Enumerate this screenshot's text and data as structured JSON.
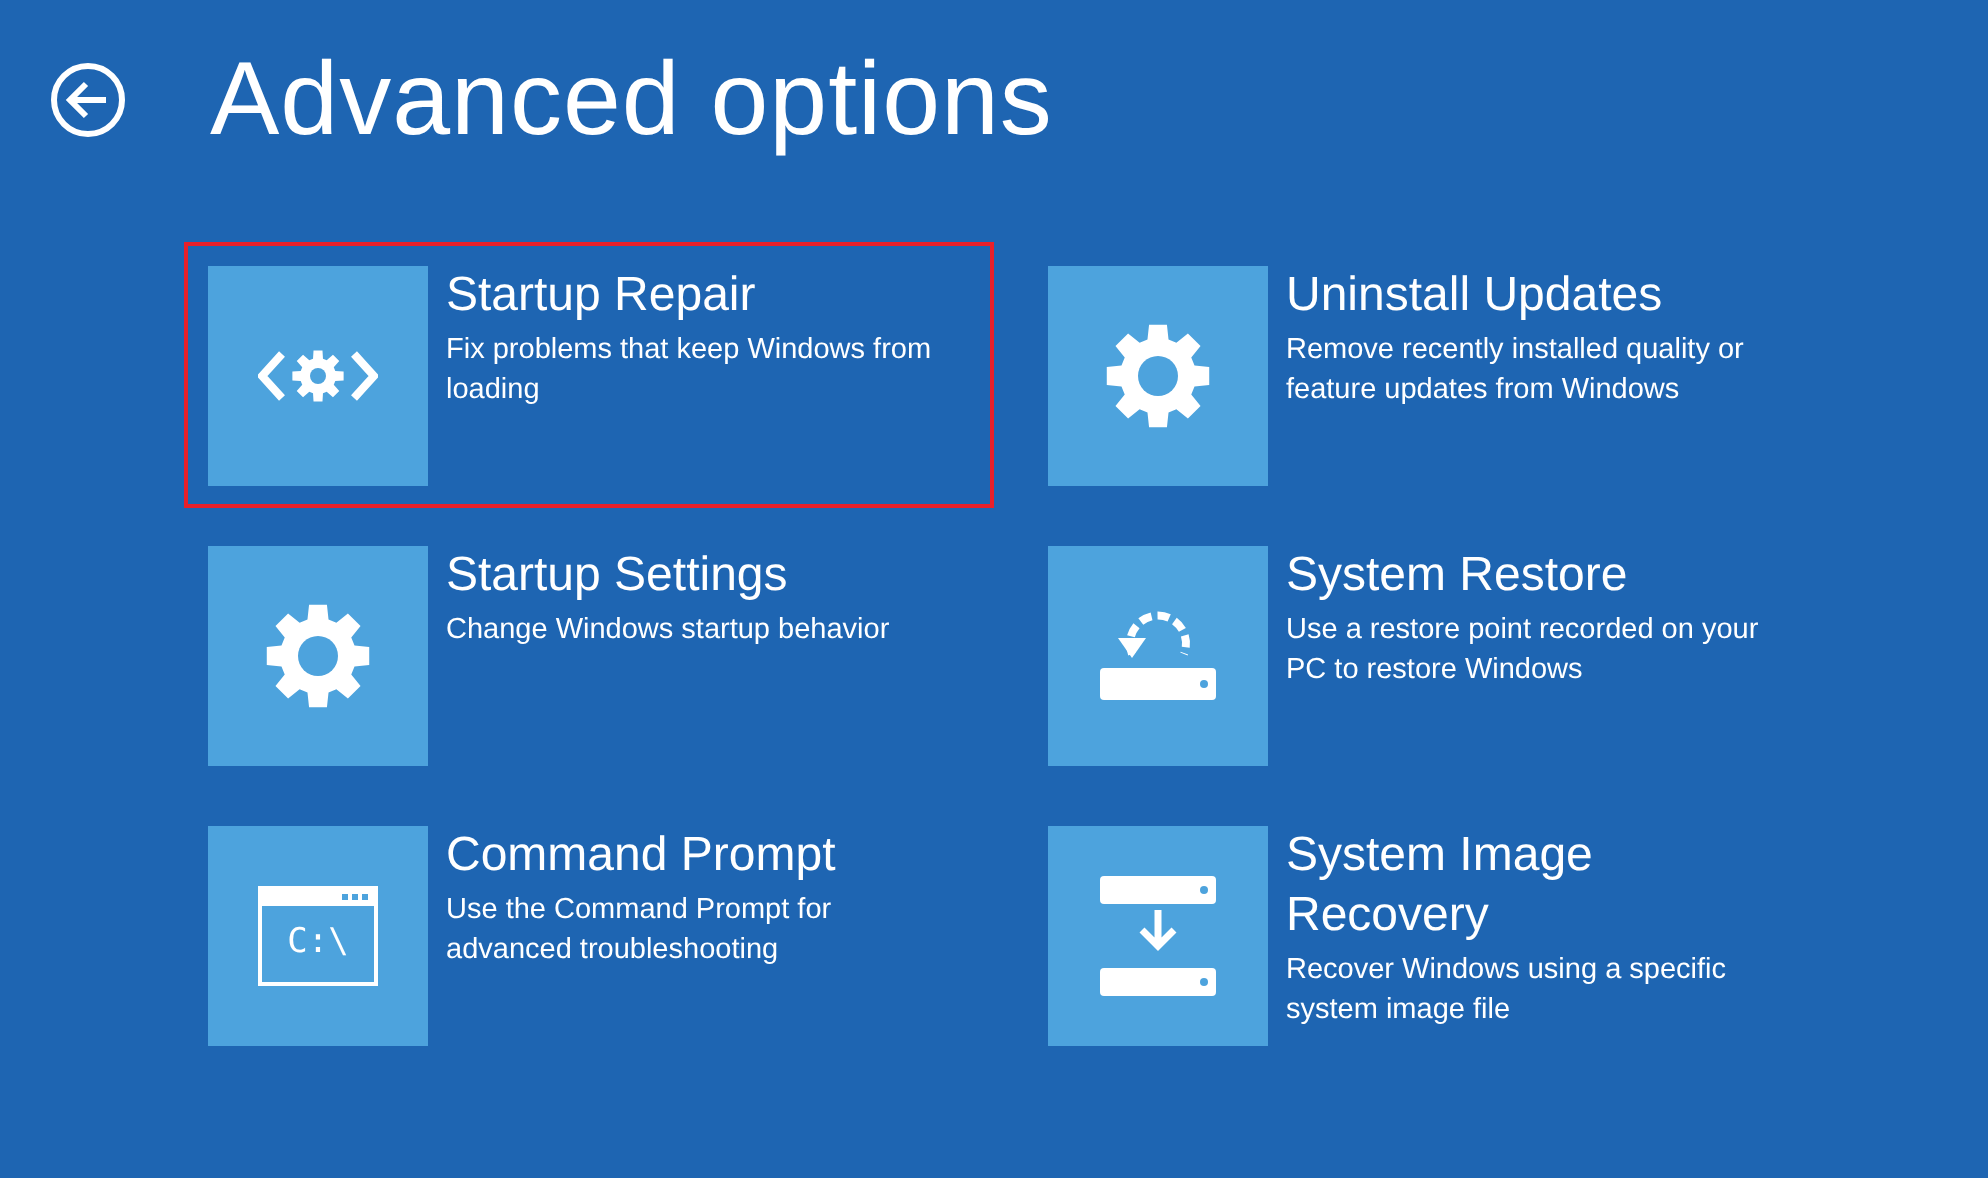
{
  "header": {
    "title": "Advanced options"
  },
  "options": [
    {
      "title": "Startup Repair",
      "description": "Fix problems that keep Windows from loading",
      "kind": "repair",
      "selected": true
    },
    {
      "title": "Uninstall Updates",
      "description": "Remove recently installed quality or feature updates from Windows",
      "kind": "gear",
      "selected": false
    },
    {
      "title": "Startup Settings",
      "description": "Change Windows startup behavior",
      "kind": "gear",
      "selected": false
    },
    {
      "title": "System Restore",
      "description": "Use a restore point recorded on your PC to restore Windows",
      "kind": "restore",
      "selected": false
    },
    {
      "title": "Command Prompt",
      "description": "Use the Command Prompt for advanced troubleshooting",
      "kind": "console",
      "icon_text": "C:\\",
      "selected": false
    },
    {
      "title": "System Image Recovery",
      "description": "Recover Windows using a specific system image file",
      "kind": "image",
      "selected": false
    }
  ]
}
